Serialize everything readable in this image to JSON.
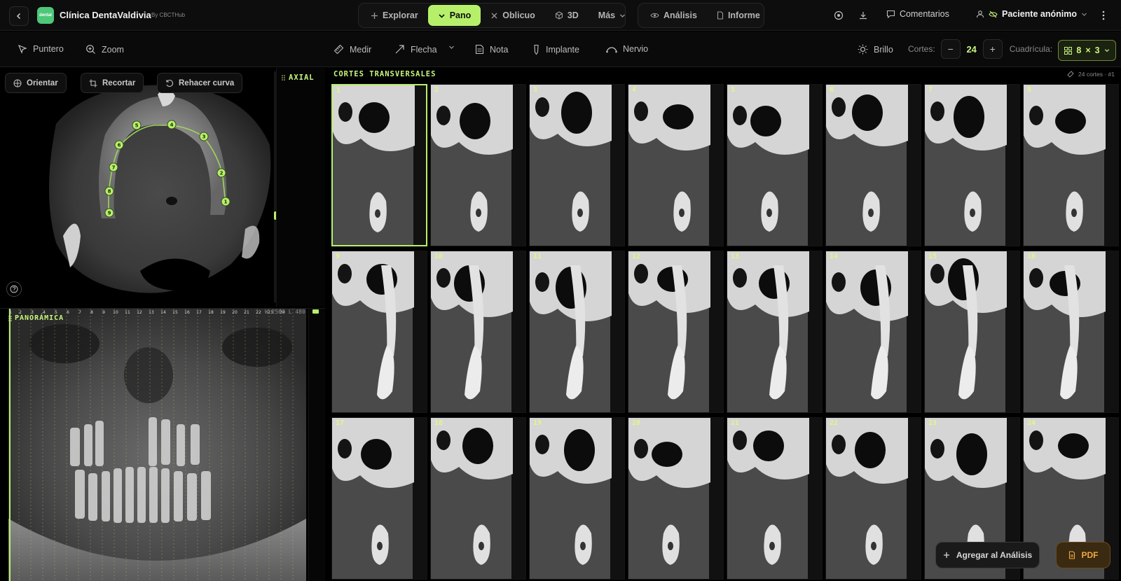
{
  "app": {
    "name": "Clínica DentaValdivia",
    "by": "By CBCTHub",
    "logo_text": "dental"
  },
  "modes": [
    {
      "label": "Explorar",
      "icon": "plus-icon",
      "active": false
    },
    {
      "label": "Pano",
      "icon": "check-icon",
      "active": true
    },
    {
      "label": "Oblicuo",
      "icon": "cross-icon",
      "active": false
    },
    {
      "label": "3D",
      "icon": "cube-icon",
      "active": false
    },
    {
      "label": "Más",
      "icon": "chevron-down-icon",
      "active": false
    }
  ],
  "tabs_right": [
    {
      "label": "Análisis",
      "icon": "eye-icon"
    },
    {
      "label": "Informe",
      "icon": "document-icon"
    }
  ],
  "header_right": {
    "comments_label": "Comentarios",
    "patient_label": "Paciente anónimo"
  },
  "tools": {
    "pointer": "Puntero",
    "zoom": "Zoom",
    "measure": "Medir",
    "arrow": "Flecha",
    "note": "Nota",
    "implant": "Implante",
    "nerve": "Nervio",
    "brightness": "Brillo",
    "slices_label": "Cortes:",
    "slices_value": "24",
    "grid_label": "Cuadrícula:",
    "grid_cols": "8",
    "grid_rows": "3",
    "grid_sep": "×",
    "minus": "−",
    "plus": "+"
  },
  "axial": {
    "label": "AXIAL",
    "buttons": {
      "orient": "Orientar",
      "crop": "Recortar",
      "redo": "Rehacer curva"
    },
    "curve_points": [
      "5",
      "4",
      "3",
      "6",
      "2",
      "7",
      "1",
      "8",
      "9"
    ]
  },
  "panoramic": {
    "label": "PANORÁMICA",
    "ruler": [
      "1",
      "2",
      "3",
      "4",
      "5",
      "6",
      "7",
      "8",
      "9",
      "10",
      "11",
      "12",
      "13",
      "14",
      "15",
      "16",
      "17",
      "18",
      "19",
      "20",
      "21",
      "22",
      "23",
      "24"
    ],
    "window_level": "W 2500 L 480"
  },
  "transversal": {
    "label": "CORTES TRANSVERSALES",
    "info": "24 cortes · #1",
    "slices": [
      "1",
      "2",
      "3",
      "4",
      "5",
      "6",
      "7",
      "8",
      "9",
      "10",
      "11",
      "12",
      "13",
      "14",
      "15",
      "16",
      "17",
      "18",
      "19",
      "20",
      "21",
      "22",
      "23",
      "24"
    ],
    "active_slice": "1"
  },
  "actions": {
    "add_analysis": "Agregar al Análisis",
    "pdf": "PDF"
  },
  "colors": {
    "accent": "#b6f06a",
    "accent_text": "#c8f57f",
    "pdf_bg": "#3a2a12",
    "pdf_text": "#f0a840"
  }
}
